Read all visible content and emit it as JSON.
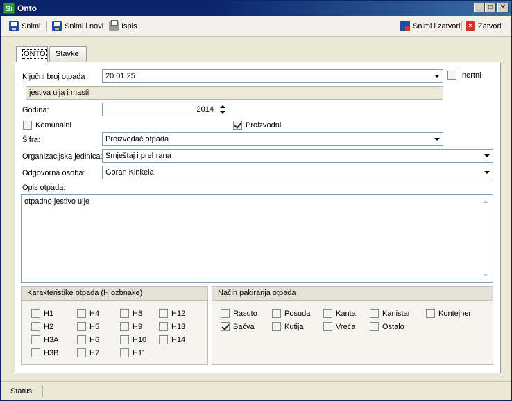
{
  "window": {
    "title": "Onto",
    "app_icon": "Si"
  },
  "toolbar": {
    "save": "Snimi",
    "save_new": "Snimi i novi",
    "print": "Ispis",
    "save_close": "Snimi i zatvori",
    "close": "Zatvori"
  },
  "tabs": [
    {
      "label": "ONTO",
      "active": true
    },
    {
      "label": "Stavke",
      "active": false
    }
  ],
  "form": {
    "kljucni_broj_label": "Ključni broj otpada",
    "kljucni_broj_value": "20 01 25",
    "inertni_label": "Inertni",
    "inertni_checked": false,
    "opis_kljuca": "jestiva ulja i masti",
    "godina_label": "Godina:",
    "godina_value": "2014",
    "komunalni_label": "Komunalni",
    "komunalni_checked": false,
    "proizvodni_label": "Proizvodni",
    "proizvodni_checked": true,
    "sifra_label": "Šifra:",
    "sifra_value": "Proizvođač otpada",
    "org_label": "Organizacijska jedinica:",
    "org_value": "Smještaj i prehrana",
    "osoba_label": "Odgovorna osoba:",
    "osoba_value": "Goran Kinkela",
    "opis_label": "Opis otpada:",
    "opis_value": "otpadno jestivo ulje"
  },
  "h_group": {
    "title": "Karakteristike otpada (H ozbnake)",
    "items": [
      {
        "label": "H1",
        "checked": false
      },
      {
        "label": "H4",
        "checked": false
      },
      {
        "label": "H8",
        "checked": false
      },
      {
        "label": "H12",
        "checked": false
      },
      {
        "label": "H2",
        "checked": false
      },
      {
        "label": "H5",
        "checked": false
      },
      {
        "label": "H9",
        "checked": false
      },
      {
        "label": "H13",
        "checked": false
      },
      {
        "label": "H3A",
        "checked": false
      },
      {
        "label": "H6",
        "checked": false
      },
      {
        "label": "H10",
        "checked": false
      },
      {
        "label": "H14",
        "checked": false
      },
      {
        "label": "H3B",
        "checked": false
      },
      {
        "label": "H7",
        "checked": false
      },
      {
        "label": "H11",
        "checked": false
      }
    ]
  },
  "pack_group": {
    "title": "Način pakiranja otpada",
    "items": [
      {
        "label": "Rasuto",
        "checked": false
      },
      {
        "label": "Posuda",
        "checked": false
      },
      {
        "label": "Kanta",
        "checked": false
      },
      {
        "label": "Kanistar",
        "checked": false
      },
      {
        "label": "Kontejner",
        "checked": false
      },
      {
        "label": "Bačva",
        "checked": true
      },
      {
        "label": "Kutija",
        "checked": false
      },
      {
        "label": "Vreća",
        "checked": false
      },
      {
        "label": "Ostalo",
        "checked": false
      }
    ]
  },
  "status": {
    "label": "Status:"
  }
}
